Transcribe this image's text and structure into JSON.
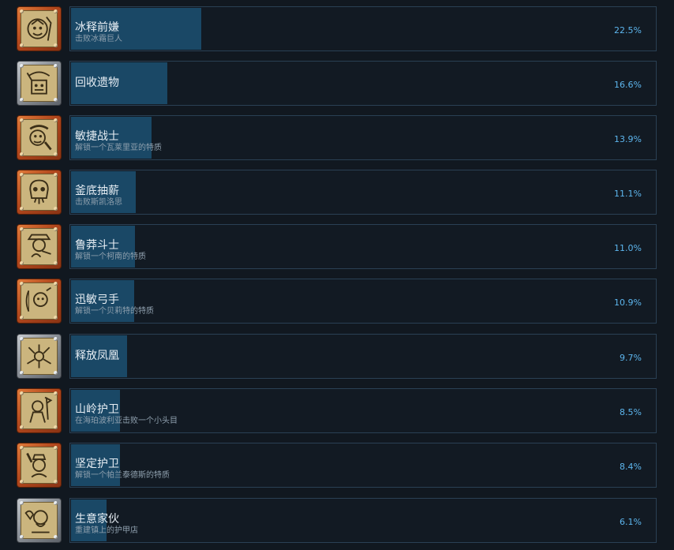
{
  "achievements": [
    {
      "name": "冰释前嫌",
      "desc": "击败冰霜巨人",
      "percent": 22.5,
      "percent_label": "22.5%",
      "frame": "bronze",
      "icon": "frost-giant-icon"
    },
    {
      "name": "回收遗物",
      "desc": "",
      "percent": 16.6,
      "percent_label": "16.6%",
      "frame": "silver",
      "icon": "relic-icon"
    },
    {
      "name": "敏捷战士",
      "desc": "解锁一个瓦莱里亚的特质",
      "percent": 13.9,
      "percent_label": "13.9%",
      "frame": "bronze",
      "icon": "warrior-icon"
    },
    {
      "name": "釜底抽薪",
      "desc": "击败斯凯洛思",
      "percent": 11.1,
      "percent_label": "11.1%",
      "frame": "bronze",
      "icon": "skull-icon"
    },
    {
      "name": "鲁莽斗士",
      "desc": "解锁一个柯南的特质",
      "percent": 11.0,
      "percent_label": "11.0%",
      "frame": "bronze",
      "icon": "fighter-icon"
    },
    {
      "name": "迅敏弓手",
      "desc": "解锁一个贝莉特的特质",
      "percent": 10.9,
      "percent_label": "10.9%",
      "frame": "bronze",
      "icon": "archer-icon"
    },
    {
      "name": "释放凤凰",
      "desc": "",
      "percent": 9.7,
      "percent_label": "9.7%",
      "frame": "silver",
      "icon": "phoenix-icon"
    },
    {
      "name": "山岭护卫",
      "desc": "在海珀波利亚击败一个小头目",
      "percent": 8.5,
      "percent_label": "8.5%",
      "frame": "bronze",
      "icon": "mountain-guard-icon"
    },
    {
      "name": "坚定护卫",
      "desc": "解锁一个帕兰泰德斯的特质",
      "percent": 8.4,
      "percent_label": "8.4%",
      "frame": "bronze",
      "icon": "guard-icon"
    },
    {
      "name": "生意家伙",
      "desc": "重建镇上的护甲店",
      "percent": 6.1,
      "percent_label": "6.1%",
      "frame": "silver",
      "icon": "merchant-icon"
    }
  ],
  "colors": {
    "background": "#111820",
    "bar_fill": "#1a4866",
    "bar_border": "#2a4054",
    "percent_text": "#5db6ee",
    "bronze_frame": "#b0461c",
    "silver_frame": "#8a8f96"
  }
}
